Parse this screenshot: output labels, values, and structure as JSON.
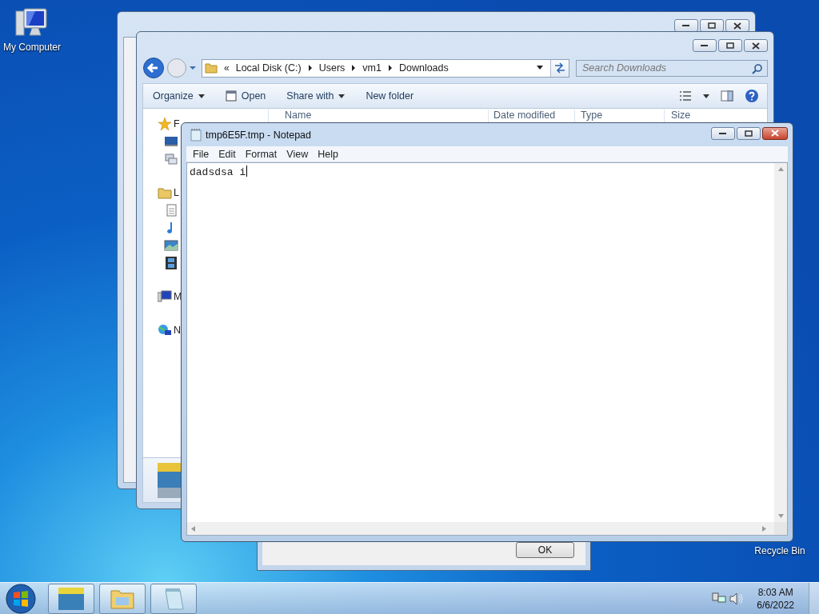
{
  "desktop_icons": [
    {
      "label": "My Computer",
      "kind": "computer"
    },
    {
      "label": "Recycle Bin",
      "kind": "bin"
    }
  ],
  "explorer": {
    "overflow": "«",
    "breadcrumb": [
      "Local Disk (C:)",
      "Users",
      "vm1",
      "Downloads"
    ],
    "search": {
      "placeholder": "Search Downloads"
    },
    "toolbar": [
      {
        "label": "Organize",
        "dropdown": true,
        "kind": "plain"
      },
      {
        "label": "Open",
        "dropdown": false,
        "kind": "open"
      },
      {
        "label": "Share with",
        "dropdown": true,
        "kind": "plain"
      },
      {
        "label": "New folder",
        "dropdown": false,
        "kind": "plain"
      }
    ],
    "columns": [
      "Name",
      "Date modified",
      "Type",
      "Size"
    ],
    "nav": [
      {
        "label": "F",
        "kind": "star"
      },
      {
        "kind": "desktop"
      },
      {
        "kind": "places"
      },
      {
        "label": "L",
        "kind": "library"
      },
      {
        "kind": "doc"
      },
      {
        "kind": "music"
      },
      {
        "kind": "pictures"
      },
      {
        "kind": "video"
      },
      {
        "label": "M",
        "kind": "computer"
      },
      {
        "label": "N",
        "kind": "network"
      }
    ]
  },
  "dialog": {
    "button": "OK"
  },
  "notepad": {
    "title": "tmp6E5F.tmp - Notepad",
    "menu": [
      "File",
      "Edit",
      "Format",
      "View",
      "Help"
    ],
    "text": "dadsdsa i"
  },
  "taskbar": {
    "time": "8:03 AM",
    "date": "6/6/2022"
  }
}
